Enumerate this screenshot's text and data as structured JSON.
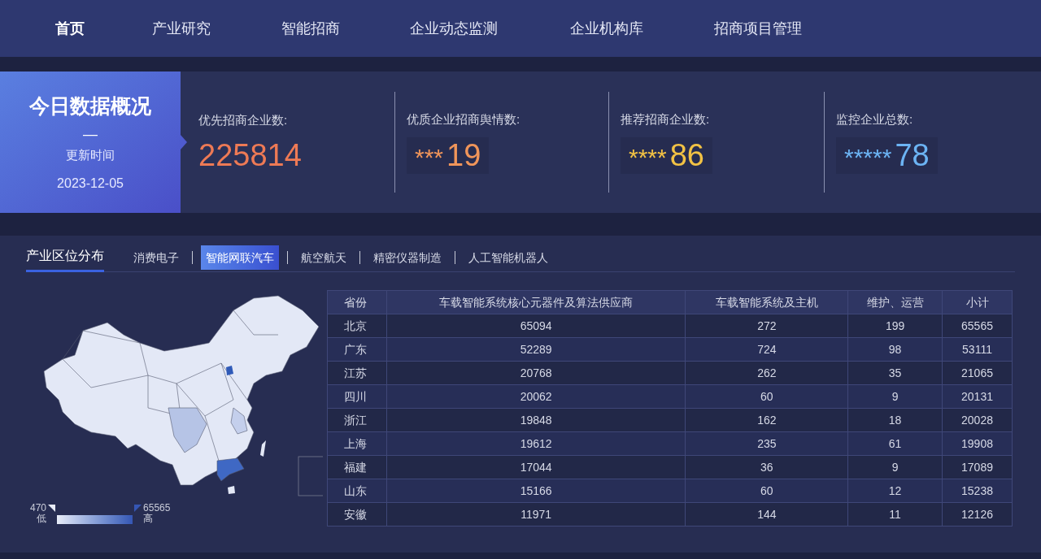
{
  "nav": [
    {
      "label": "首页",
      "selected": true
    },
    {
      "label": "产业研究",
      "selected": false
    },
    {
      "label": "智能招商",
      "selected": false
    },
    {
      "label": "企业动态监测",
      "selected": false
    },
    {
      "label": "企业机构库",
      "selected": false
    },
    {
      "label": "招商项目管理",
      "selected": false
    }
  ],
  "overview": {
    "title": "今日数据概况",
    "divider": "—",
    "update_label": "更新时间",
    "date": "2023-12-05"
  },
  "stats": [
    {
      "label": "优先招商企业数:",
      "value": "225814",
      "color": "#ee7a55"
    },
    {
      "label": "优质企业招商舆情数:",
      "mask": "***",
      "value": "19",
      "color": "#f0955a"
    },
    {
      "label": "推荐招商企业数:",
      "mask": "****",
      "value": "86",
      "color": "#f2c244"
    },
    {
      "label": "监控企业总数:",
      "mask": "*****",
      "value": "78",
      "color": "#6cb4f4"
    }
  ],
  "section_title": "产业区位分布",
  "industry_tabs": [
    {
      "label": "消费电子",
      "selected": false
    },
    {
      "label": "智能网联汽车",
      "selected": true
    },
    {
      "label": "航空航天",
      "selected": false
    },
    {
      "label": "精密仪器制造",
      "selected": false
    },
    {
      "label": "人工智能机器人",
      "selected": false
    }
  ],
  "map_legend": {
    "min": "470",
    "min_label": "低",
    "max": "65565",
    "max_label": "高"
  },
  "table": {
    "columns": [
      "省份",
      "车载智能系统核心元器件及算法供应商",
      "车载智能系统及主机",
      "维护、运营",
      "小计"
    ],
    "rows": [
      [
        "北京",
        "65094",
        "272",
        "199",
        "65565"
      ],
      [
        "广东",
        "52289",
        "724",
        "98",
        "53111"
      ],
      [
        "江苏",
        "20768",
        "262",
        "35",
        "21065"
      ],
      [
        "四川",
        "20062",
        "60",
        "9",
        "20131"
      ],
      [
        "浙江",
        "19848",
        "162",
        "18",
        "20028"
      ],
      [
        "上海",
        "19612",
        "235",
        "61",
        "19908"
      ],
      [
        "福建",
        "17044",
        "36",
        "9",
        "17089"
      ],
      [
        "山东",
        "15166",
        "60",
        "12",
        "15238"
      ],
      [
        "安徽",
        "11971",
        "144",
        "11",
        "12126"
      ]
    ]
  }
}
